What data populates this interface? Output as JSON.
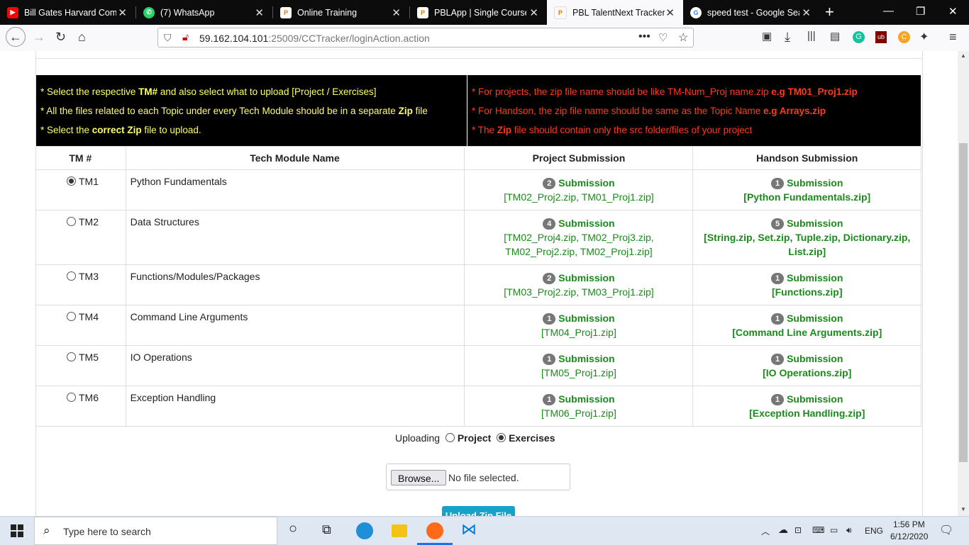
{
  "browser": {
    "tabs": [
      {
        "title": "Bill Gates Harvard Comm",
        "favicon": "youtube-icon",
        "color": "#ff0000"
      },
      {
        "title": "(7) WhatsApp",
        "favicon": "whatsapp-icon",
        "color": "#25d366"
      },
      {
        "title": "Online Training",
        "favicon": "pbl-icon",
        "color": "#ffffff"
      },
      {
        "title": "PBLApp | Single Course",
        "favicon": "pbl-icon",
        "color": "#ffffff"
      },
      {
        "title": "PBL TalentNext Tracker",
        "favicon": "pbl-icon",
        "color": "#ffffff"
      },
      {
        "title": "speed test - Google Searc",
        "favicon": "google-icon",
        "color": "#ffffff"
      }
    ],
    "url_host": "59.162.104.101",
    "url_rest": ":25009/CCTracker/loginAction.action"
  },
  "info": {
    "left": {
      "l1a": "* Select the respective ",
      "l1b": "TM#",
      "l1c": " and also select what to upload [Project / Exercises]",
      "l2a": "* All the files related to each Topic under every Tech Module should be in a separate ",
      "l2b": "Zip",
      "l2c": " file",
      "l3a": "* Select the ",
      "l3b": "correct Zip",
      "l3c": " file to upload."
    },
    "right": {
      "l1a": "* For projects, the zip file name should be like TM-Num_Proj name.zip ",
      "l1b": "e.g TM01_Proj1.zip",
      "l2a": "* For Handson, the zip file name should be same as the Topic Name ",
      "l2b": "e.g Arrays.zip",
      "l3a": "* The ",
      "l3b": "Zip",
      "l3c": " file should contain only the src folder/files of your project"
    }
  },
  "table": {
    "headers": [
      "TM #",
      "Tech Module Name",
      "Project Submission",
      "Handson Submission"
    ],
    "submission_label": "Submission",
    "rows": [
      {
        "tm": "TM1",
        "name": "Python Fundamentals",
        "p_count": "2",
        "p_files": "[TM02_Proj2.zip, TM01_Proj1.zip]",
        "h_count": "1",
        "h_files": "[Python Fundamentals.zip]"
      },
      {
        "tm": "TM2",
        "name": "Data Structures",
        "p_count": "4",
        "p_files": "[TM02_Proj4.zip, TM02_Proj3.zip, TM02_Proj2.zip, TM02_Proj1.zip]",
        "h_count": "5",
        "h_files": "[String.zip, Set.zip, Tuple.zip, Dictionary.zip, List.zip]"
      },
      {
        "tm": "TM3",
        "name": "Functions/Modules/Packages",
        "p_count": "2",
        "p_files": "[TM03_Proj2.zip, TM03_Proj1.zip]",
        "h_count": "1",
        "h_files": "[Functions.zip]"
      },
      {
        "tm": "TM4",
        "name": "Command Line Arguments",
        "p_count": "1",
        "p_files": "[TM04_Proj1.zip]",
        "h_count": "1",
        "h_files": "[Command Line Arguments.zip]"
      },
      {
        "tm": "TM5",
        "name": "IO Operations",
        "p_count": "1",
        "p_files": "[TM05_Proj1.zip]",
        "h_count": "1",
        "h_files": "[IO Operations.zip]"
      },
      {
        "tm": "TM6",
        "name": "Exception Handling",
        "p_count": "1",
        "p_files": "[TM06_Proj1.zip]",
        "h_count": "1",
        "h_files": "[Exception Handling.zip]"
      }
    ]
  },
  "upload": {
    "label": "Uploading",
    "option_project": "Project",
    "option_exercises": "Exercises",
    "browse": "Browse...",
    "no_file": "No file selected.",
    "button": "Upload Zip File"
  },
  "taskbar": {
    "search_placeholder": "Type here to search",
    "lang": "ENG",
    "time": "1:56 PM",
    "date": "6/12/2020"
  }
}
